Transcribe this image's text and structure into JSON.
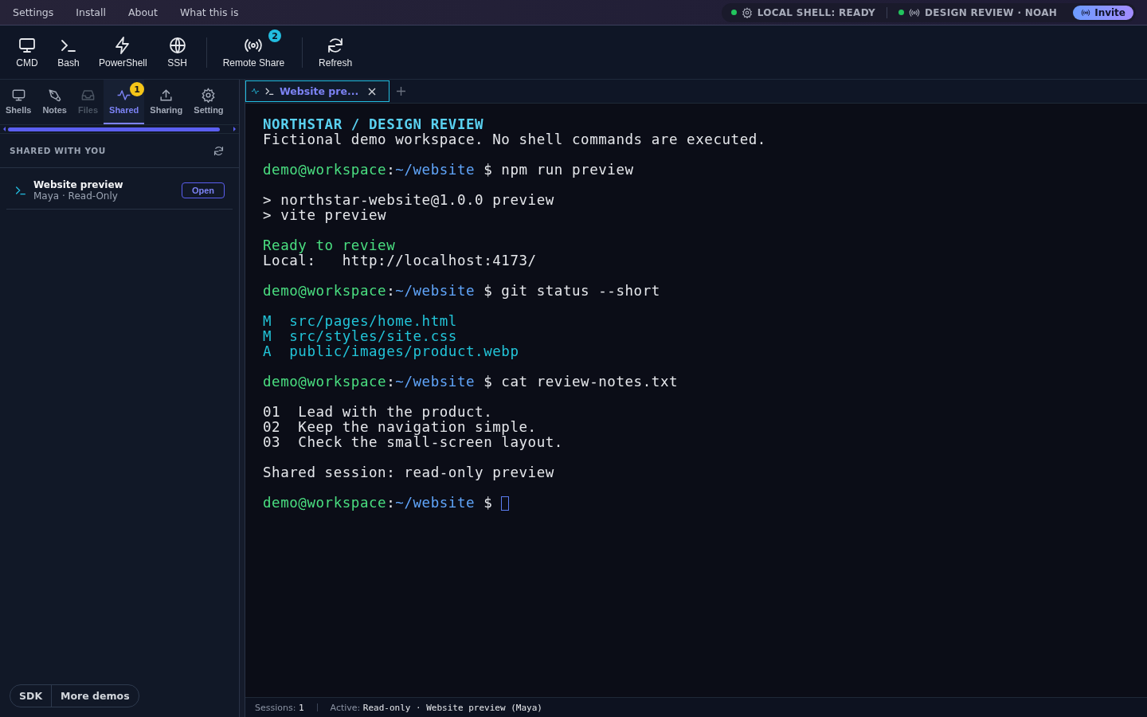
{
  "menu": [
    "Settings",
    "Install",
    "About",
    "What this is"
  ],
  "status_pills": [
    {
      "kind": "gear",
      "label": "LOCAL SHELL: READY",
      "color": "#22c55e"
    },
    {
      "kind": "signal",
      "label": "DESIGN REVIEW · NOAH",
      "color": "#22c55e"
    }
  ],
  "invite_button": "Invite",
  "toolbar": [
    {
      "kind": "monitor",
      "label": "CMD"
    },
    {
      "kind": "prompt",
      "label": "Bash"
    },
    {
      "kind": "bolt",
      "label": "PowerShell"
    },
    {
      "kind": "globe",
      "label": "SSH"
    },
    {
      "kind": "divider"
    },
    {
      "kind": "signal",
      "label": "Remote Share",
      "badge": "2"
    },
    {
      "kind": "divider"
    },
    {
      "kind": "refresh",
      "label": "Refresh"
    }
  ],
  "sidebar": {
    "tabs": [
      {
        "kind": "monitor",
        "label": "Shells",
        "selected": false,
        "disabled": false
      },
      {
        "kind": "pen",
        "label": "Notes",
        "selected": false,
        "disabled": false
      },
      {
        "kind": "inbox",
        "label": "Files",
        "selected": false,
        "disabled": true
      },
      {
        "kind": "pulse",
        "label": "Shared",
        "selected": true,
        "disabled": false,
        "badge": "1"
      },
      {
        "kind": "upload",
        "label": "Sharing",
        "selected": false,
        "disabled": false
      },
      {
        "kind": "gear",
        "label": "Setting",
        "selected": false,
        "disabled": false
      }
    ],
    "section_title": "SHARED WITH YOU",
    "sessions": [
      {
        "title": "Website preview",
        "subtitle": "Maya · Read-Only",
        "action": "Open"
      }
    ],
    "footer_buttons": [
      "SDK",
      "More demos"
    ]
  },
  "terminal_tabs": [
    {
      "title": "Website pre...",
      "selected": true
    }
  ],
  "terminal": {
    "blocks": [
      [
        [
          {
            "kind": "heading",
            "text": "NORTHSTAR / DESIGN REVIEW"
          }
        ],
        [
          {
            "kind": "plain",
            "text": "Fictional demo workspace. No shell commands are executed."
          }
        ]
      ],
      [
        [
          {
            "kind": "user",
            "text": "demo@workspace"
          },
          {
            "kind": "plain",
            "text": ":"
          },
          {
            "kind": "path",
            "text": "~/website"
          },
          {
            "kind": "plain",
            "text": " $ npm run preview"
          }
        ]
      ],
      [
        [
          {
            "kind": "plain",
            "text": "> northstar-website@1.0.0 preview"
          }
        ],
        [
          {
            "kind": "plain",
            "text": "> vite preview"
          }
        ]
      ],
      [
        [
          {
            "kind": "success",
            "text": "Ready to review"
          }
        ],
        [
          {
            "kind": "plain",
            "text": "Local:   http://localhost:4173/"
          }
        ]
      ],
      [
        [
          {
            "kind": "user",
            "text": "demo@workspace"
          },
          {
            "kind": "plain",
            "text": ":"
          },
          {
            "kind": "path",
            "text": "~/website"
          },
          {
            "kind": "plain",
            "text": " $ git status --short"
          }
        ]
      ],
      [
        [
          {
            "kind": "git",
            "text": "M  src/pages/home.html"
          }
        ],
        [
          {
            "kind": "git",
            "text": "M  src/styles/site.css"
          }
        ],
        [
          {
            "kind": "git",
            "text": "A  public/images/product.webp"
          }
        ]
      ],
      [
        [
          {
            "kind": "user",
            "text": "demo@workspace"
          },
          {
            "kind": "plain",
            "text": ":"
          },
          {
            "kind": "path",
            "text": "~/website"
          },
          {
            "kind": "plain",
            "text": " $ cat review-notes.txt"
          }
        ]
      ],
      [
        [
          {
            "kind": "plain",
            "text": "01  Lead with the product."
          }
        ],
        [
          {
            "kind": "plain",
            "text": "02  Keep the navigation simple."
          }
        ],
        [
          {
            "kind": "plain",
            "text": "03  Check the small-screen layout."
          }
        ]
      ],
      [
        [
          {
            "kind": "plain",
            "text": "Shared session: read-only preview"
          }
        ]
      ],
      [
        [
          {
            "kind": "user",
            "text": "demo@workspace"
          },
          {
            "kind": "plain",
            "text": ":"
          },
          {
            "kind": "path",
            "text": "~/website"
          },
          {
            "kind": "plain",
            "text": " $ "
          }
        ]
      ]
    ],
    "cursor": true
  },
  "status_bar": {
    "sessions_label": "Sessions:",
    "sessions_value": "1",
    "active_label": "Active:",
    "active_value": "Read-only · Website preview (Maya)"
  }
}
